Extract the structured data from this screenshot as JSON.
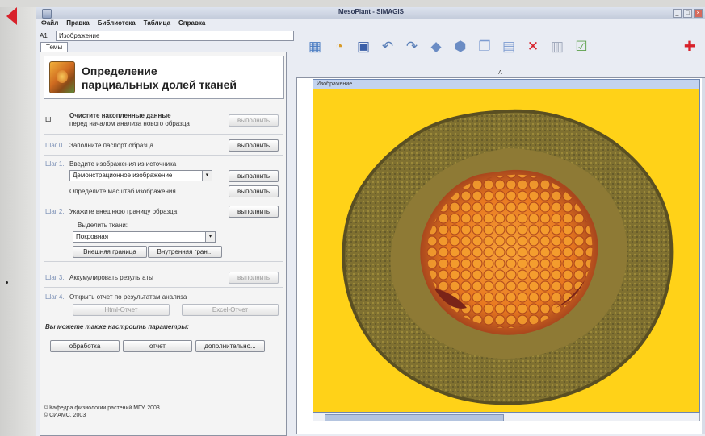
{
  "window": {
    "title": "MesoPlant - SIMAGIS",
    "controls": [
      "_",
      "□",
      "×"
    ]
  },
  "menu": [
    "Файл",
    "Правка",
    "Библиотека",
    "Таблица",
    "Справка"
  ],
  "cell": {
    "ref": "A1",
    "value": "Изображение"
  },
  "tab": "Темы",
  "header": {
    "title_line1": "Определение",
    "title_line2": "парциальных долей тканей"
  },
  "steps": {
    "clear": {
      "prefix": "Ш",
      "text1": "Очистите накопленные данные",
      "text2": "перед началом анализа нового образца",
      "button": "выполнить"
    },
    "step0": {
      "label": "Шаг 0.",
      "text": "Заполните паспорт образца",
      "button": "выполнить"
    },
    "step1": {
      "label": "Шаг 1.",
      "text": "Введите изображения из источника",
      "source": "Демонстрационное изображение",
      "button": "выполнить",
      "scale_text": "Определите масштаб изображения",
      "scale_button": "выполнить"
    },
    "step2": {
      "label": "Шаг 2.",
      "text": "Укажите внешнюю границу образца",
      "button": "выполнить",
      "select_text": "Выделить ткани:",
      "tissue": "Покровная",
      "outer_button": "Внешняя граница",
      "inner_button": "Внутренняя гран..."
    },
    "step3": {
      "label": "Шаг 3.",
      "text": "Аккумулировать результаты",
      "button": "выполнить"
    },
    "step4": {
      "label": "Шаг 4.",
      "text": "Открыть отчет по результатам анализа",
      "html_button": "Html-Отчет",
      "excel_button": "Excel-Отчет"
    }
  },
  "params": {
    "text": "Вы можете также настроить параметры:",
    "buttons": [
      "обработка",
      "отчет",
      "дополнительно..."
    ]
  },
  "footer": {
    "line1": "© Кафедра физиологии растений МГУ, 2003",
    "line2": "© СИАМС, 2003"
  },
  "sheet": {
    "column": "A",
    "row": "1",
    "image_caption": "Изображение"
  },
  "colors": {
    "accent": "#d8222b",
    "image_background": "#ffd218",
    "caption_bar": "#c3d3ef"
  },
  "toolbar_icons": [
    "table-icon",
    "open-icon",
    "save-icon",
    "undo-icon",
    "redo-icon",
    "select-icon",
    "crop-icon",
    "copy-icon",
    "paste-icon",
    "delete-icon",
    "clipboard-icon",
    "properties-icon",
    "help-icon"
  ]
}
